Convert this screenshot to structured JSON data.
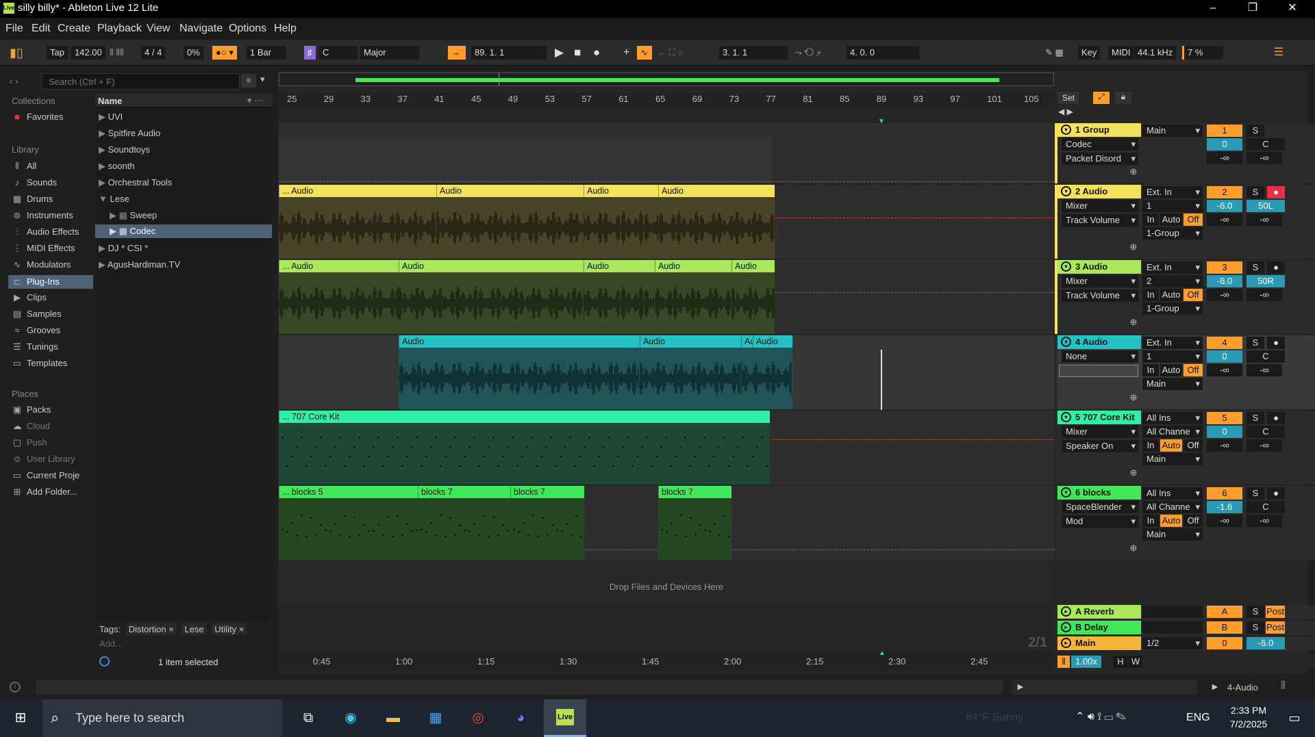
{
  "window": {
    "title": "silly billy* - Ableton Live 12 Lite",
    "logo": "Live",
    "min": "–",
    "restore": "❐",
    "close": "✕"
  },
  "menu": [
    "File",
    "Edit",
    "Create",
    "Playback",
    "View",
    "Navigate",
    "Options",
    "Help"
  ],
  "control": {
    "tap": "Tap",
    "tempo": "142.00",
    "sig": "4 / 4",
    "swing": "0%",
    "quant": "1 Bar",
    "key": "C",
    "scale": "Major",
    "arr_pos": "89.   1.   1",
    "punch_start": "3.   1.   1",
    "punch_len": "4.   0.   0",
    "key_btn": "Key",
    "midi_btn": "MIDI",
    "sample_rate": "44.1 kHz",
    "cpu": "7 %"
  },
  "browser": {
    "search_placeholder": "Search (Ctrl + F)",
    "collections_title": "Collections",
    "favorites": "Favorites",
    "library_title": "Library",
    "library": [
      "All",
      "Sounds",
      "Drums",
      "Instruments",
      "Audio Effects",
      "MIDI Effects",
      "Modulators",
      "Plug-Ins",
      "Clips",
      "Samples",
      "Grooves",
      "Tunings",
      "Templates"
    ],
    "places_title": "Places",
    "places": [
      "Packs",
      "Cloud",
      "Push",
      "User Library",
      "Current Proje",
      "Add Folder..."
    ],
    "name_header": "Name",
    "items": [
      "UVI",
      "Spitfire Audio",
      "Soundtoys",
      "soonth",
      "Orchestral Tools",
      "Lese",
      "Sweep",
      "Codec",
      "DJ * CSI *",
      "AgusHardiman.TV"
    ],
    "tags_label": "Tags:",
    "tags": [
      "Distortion",
      "Lese",
      "Utility"
    ],
    "add": "Add...",
    "status": "1 item selected"
  },
  "ruler": [
    "25",
    "29",
    "33",
    "37",
    "41",
    "45",
    "49",
    "53",
    "57",
    "61",
    "65",
    "69",
    "73",
    "77",
    "81",
    "85",
    "89",
    "93",
    "97",
    "101",
    "105"
  ],
  "time": [
    "0:45",
    "1:00",
    "1:15",
    "1:30",
    "1:45",
    "2:00",
    "2:15",
    "2:30",
    "2:45"
  ],
  "set_btn": "Set",
  "drop_text": "Drop Files and Devices Here",
  "zoom_ratio": "2/1",
  "tracks": [
    {
      "name": "1 Group",
      "color": "#f5e15c",
      "num": "1",
      "dev": "Codec",
      "chooser": "Packet Disord",
      "out": "Main",
      "vol": "0",
      "pan": "C",
      "s": "S"
    },
    {
      "name": "2 Audio",
      "color": "#f5e15c",
      "num": "2",
      "dev": "Mixer",
      "chooser": "Track Volume",
      "in": "Ext. In",
      "ch": "1",
      "out": "1-Group",
      "vol": "-6.0",
      "pan": "50L",
      "s": "S"
    },
    {
      "name": "3 Audio",
      "color": "#a9e85a",
      "num": "3",
      "dev": "Mixer",
      "chooser": "Track Volume",
      "in": "Ext. In",
      "ch": "2",
      "out": "1-Group",
      "vol": "-6.0",
      "pan": "50R",
      "s": "S"
    },
    {
      "name": "4 Audio",
      "color": "#22c2c5",
      "num": "4",
      "dev": "None",
      "in": "Ext. In",
      "ch": "1",
      "out": "Main",
      "vol": "0",
      "pan": "C",
      "s": "S"
    },
    {
      "name": "5 707 Core Kit",
      "color": "#2ef0a6",
      "num": "5",
      "dev": "Mixer",
      "chooser": "Speaker On",
      "in": "All Ins",
      "ch": "All Channe",
      "out": "Main",
      "vol": "0",
      "pan": "C",
      "s": "S"
    },
    {
      "name": "6 blocks",
      "color": "#3ee857",
      "num": "6",
      "dev": "SpaceBlender",
      "chooser": "Mod",
      "in": "All Ins",
      "ch": "All Channe",
      "out": "Main",
      "vol": "-1.6",
      "pan": "C",
      "s": "S"
    }
  ],
  "monitor": {
    "in": "In",
    "auto": "Auto",
    "off": "Off",
    "inf": "-∞"
  },
  "returns": [
    {
      "name": "A Reverb",
      "color": "#a9e85a",
      "letter": "A",
      "post": "Post",
      "s": "S"
    },
    {
      "name": "B Delay",
      "color": "#3ee857",
      "letter": "B",
      "post": "Post",
      "s": "S"
    },
    {
      "name": "Main",
      "color": "#f5b63a",
      "letter": "0",
      "sel": "1/2",
      "vol": "-6.0"
    }
  ],
  "zoom_value": "1.00x",
  "h_btn": "H",
  "w_btn": "W",
  "clips": {
    "t2": [
      {
        "label": "... Audio"
      },
      {
        "label": "Audio"
      },
      {
        "label": "Audio"
      },
      {
        "label": "Audio"
      }
    ],
    "t3": [
      {
        "label": "... Audio"
      },
      {
        "label": "Audio"
      },
      {
        "label": "Audio"
      },
      {
        "label": "Audio"
      },
      {
        "label": "Audio"
      }
    ],
    "t4": [
      {
        "label": "Audio"
      },
      {
        "label": "Audio"
      },
      {
        "label": "Au"
      },
      {
        "label": "Audio"
      }
    ],
    "t5": [
      {
        "label": "... 707 Core Kit"
      }
    ],
    "t6": [
      {
        "label": "... blocks 5"
      },
      {
        "label": "blocks 7"
      },
      {
        "label": "blocks 7"
      },
      {
        "label": "blocks 7"
      }
    ]
  },
  "status_track": "4-Audio",
  "taskbar": {
    "search": "Type here to search",
    "weather": "84°F Sunny",
    "lang": "ENG",
    "time": "2:33 PM",
    "date": "7/2/2025",
    "live": "Live"
  }
}
